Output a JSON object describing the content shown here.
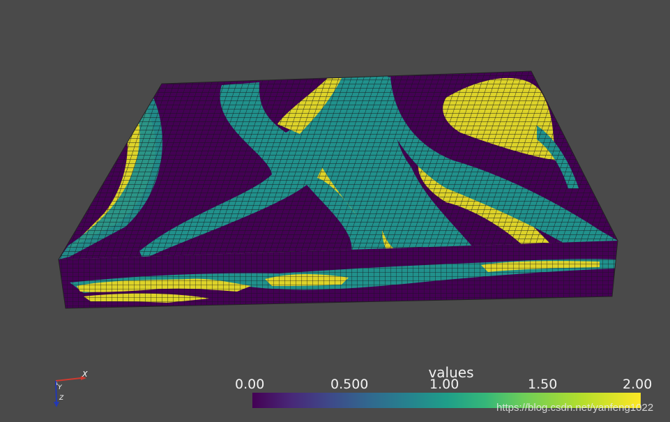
{
  "viewer": {
    "background": "#4a4a4a",
    "mesh_edge_color": "#1a1a1a"
  },
  "colormap": {
    "name": "viridis",
    "stops": [
      "#440154",
      "#482878",
      "#3e4989",
      "#31688e",
      "#26828e",
      "#1f9e89",
      "#35b779",
      "#6ece58",
      "#b5de2b",
      "#fde725"
    ],
    "class_colors": {
      "0": "#440154",
      "1": "#21918c",
      "2": "#e0d71c"
    }
  },
  "scalar_bar": {
    "title": "values",
    "ticks": [
      "0.00",
      "0.500",
      "1.00",
      "1.50",
      "2.00"
    ],
    "range": [
      0,
      2
    ]
  },
  "axes_widget": {
    "x_label": "X",
    "y_label": "Y",
    "z_label": "Z"
  },
  "watermark": "https://blog.csdn.net/yanfeng1022"
}
